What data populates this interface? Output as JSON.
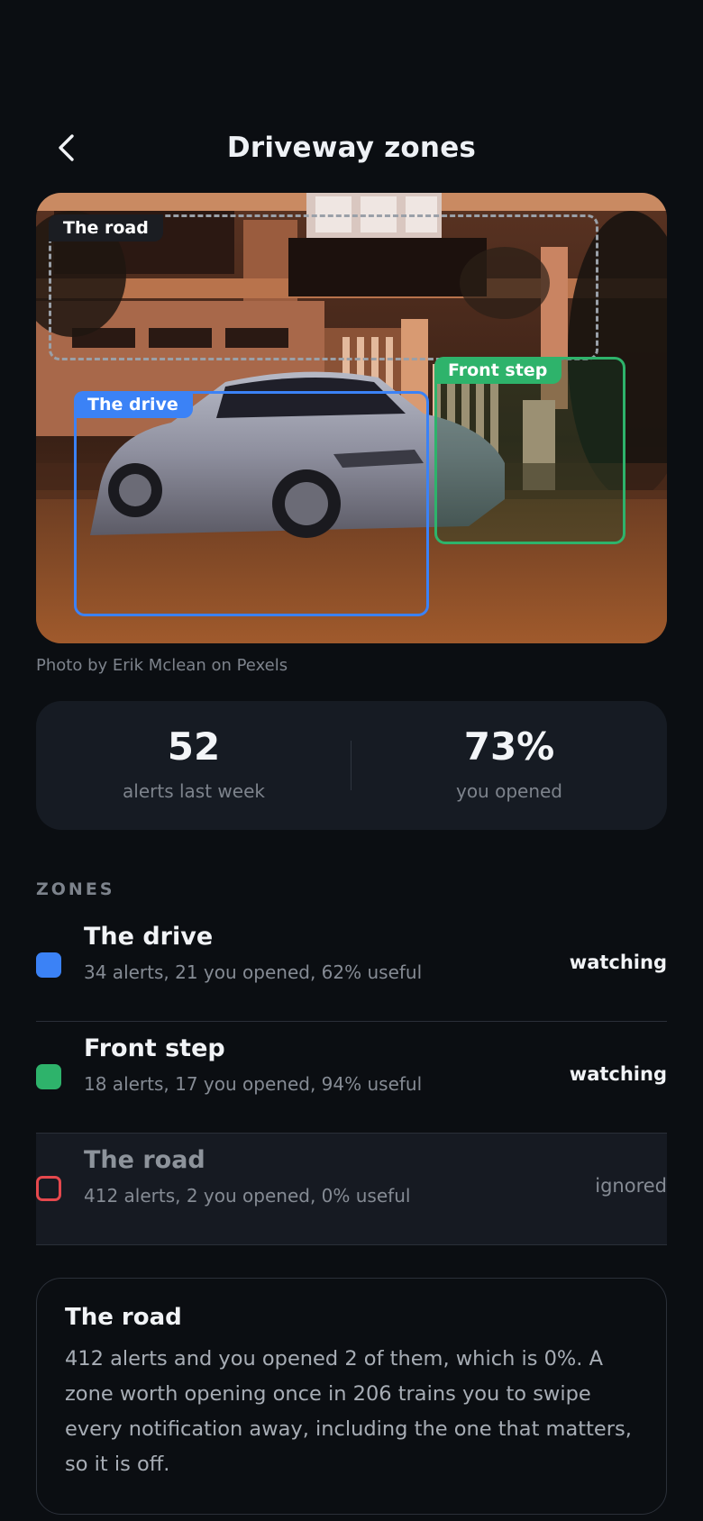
{
  "header": {
    "title": "Driveway zones",
    "back_icon": "chevron-left-icon"
  },
  "photo": {
    "credit": "Photo by Erik Mclean on Pexels",
    "zones": [
      {
        "label": "The drive",
        "color": "#3b82f6",
        "style": "solid"
      },
      {
        "label": "Front step",
        "color": "#2eb36b",
        "style": "solid"
      },
      {
        "label": "The road",
        "color": "#9aa0a8",
        "style": "dashed"
      }
    ]
  },
  "stats": {
    "alerts": {
      "value": "52",
      "label": "alerts last week"
    },
    "opened": {
      "value": "73%",
      "label": "you opened"
    }
  },
  "zones_section": {
    "label": "ZONES",
    "items": [
      {
        "name": "The drive",
        "meta": "34 alerts, 21 you opened, 62% useful",
        "status": "watching",
        "color": "#3b82f6",
        "enabled": true
      },
      {
        "name": "Front step",
        "meta": "18 alerts, 17 you opened, 94% useful",
        "status": "watching",
        "color": "#2eb36b",
        "enabled": true
      },
      {
        "name": "The road",
        "meta": "412 alerts, 2 you opened, 0% useful",
        "status": "ignored",
        "color": "#e5484d",
        "enabled": false
      }
    ]
  },
  "info": {
    "title": "The road",
    "body": "412 alerts and you opened 2 of them, which is 0%. A zone worth opening once in 206 trains you to swipe every notification away, including the one that matters, so it is off."
  }
}
